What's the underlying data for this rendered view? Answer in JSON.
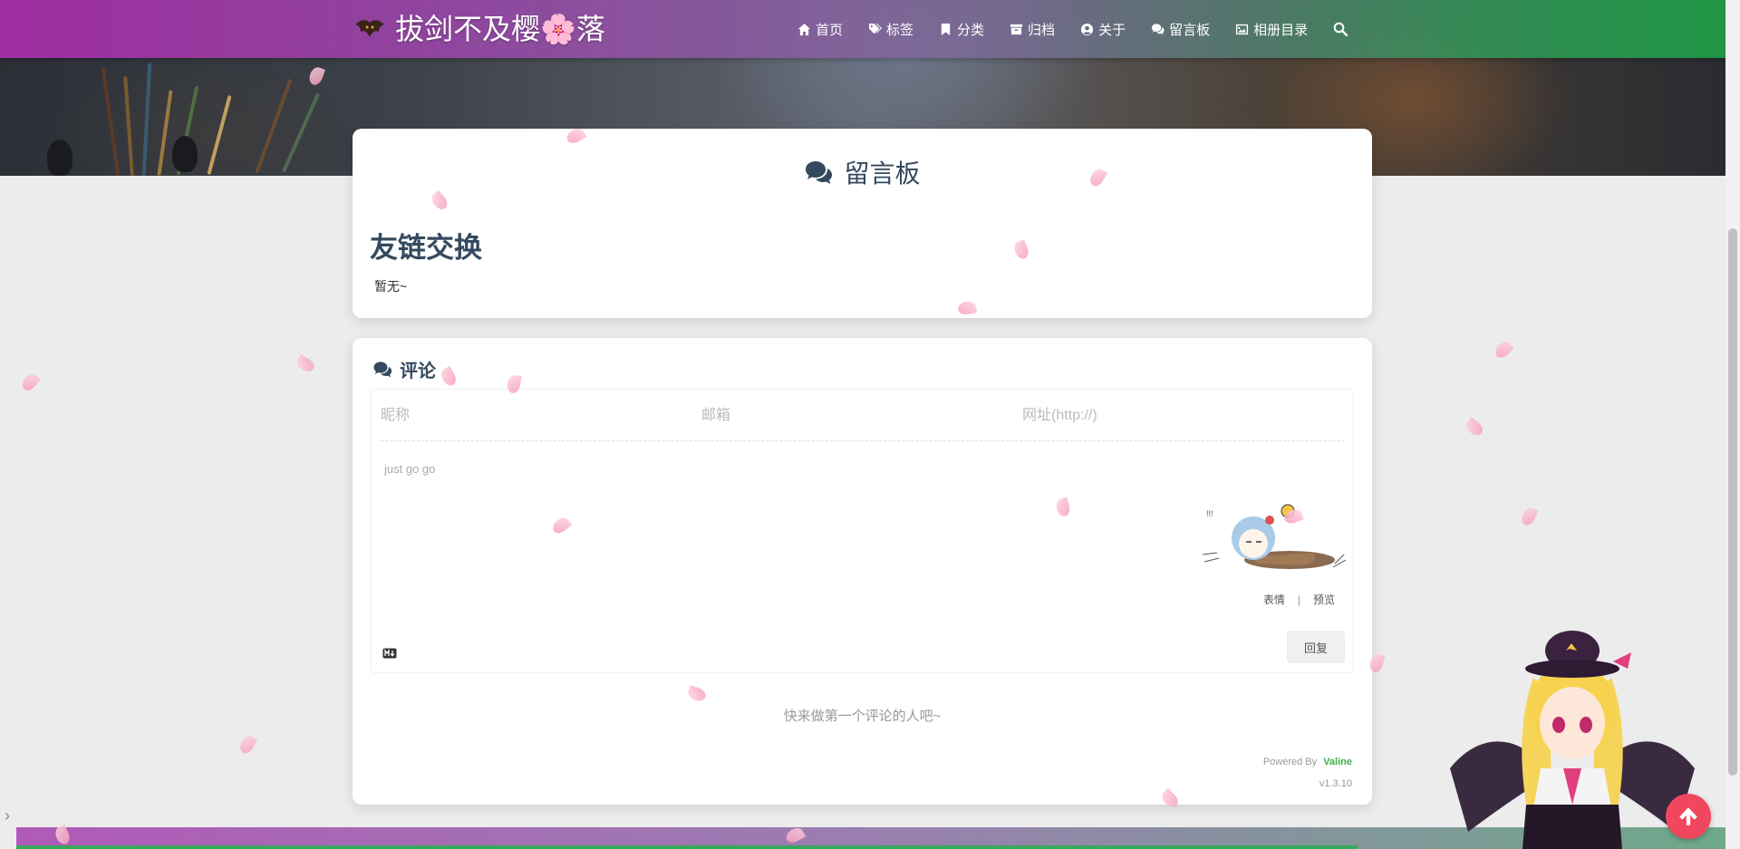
{
  "site": {
    "title": "拔剑不及樱🌸落",
    "logo_icon": "bat-logo-icon"
  },
  "nav": {
    "items": [
      {
        "label": "首页",
        "icon": "home-icon"
      },
      {
        "label": "标签",
        "icon": "tags-icon"
      },
      {
        "label": "分类",
        "icon": "bookmark-icon"
      },
      {
        "label": "归档",
        "icon": "archive-icon"
      },
      {
        "label": "关于",
        "icon": "user-circle-icon"
      },
      {
        "label": "留言板",
        "icon": "comments-icon"
      },
      {
        "label": "相册目录",
        "icon": "image-icon"
      }
    ],
    "search_icon": "search-icon"
  },
  "guestbook": {
    "page_title": "留言板",
    "heading": "友链交换",
    "text": "暂无~"
  },
  "comments": {
    "title": "评论",
    "nick_placeholder": "昵称",
    "mail_placeholder": "邮箱",
    "link_placeholder": "网址(http://)",
    "textarea_placeholder": "just go go",
    "emoji_label": "表情",
    "separator": "|",
    "preview_label": "预览",
    "reply_label": "回复",
    "empty_text": "快来做第一个评论的人吧~",
    "powered_by": "Powered By",
    "powered_brand": "Valine",
    "version": "v1.3.10"
  },
  "colors": {
    "nav_start": "#a82daa",
    "nav_end": "#1ea046",
    "heading": "#34495e",
    "valine_green": "#3eaf43",
    "back_top": "#f0465e"
  }
}
